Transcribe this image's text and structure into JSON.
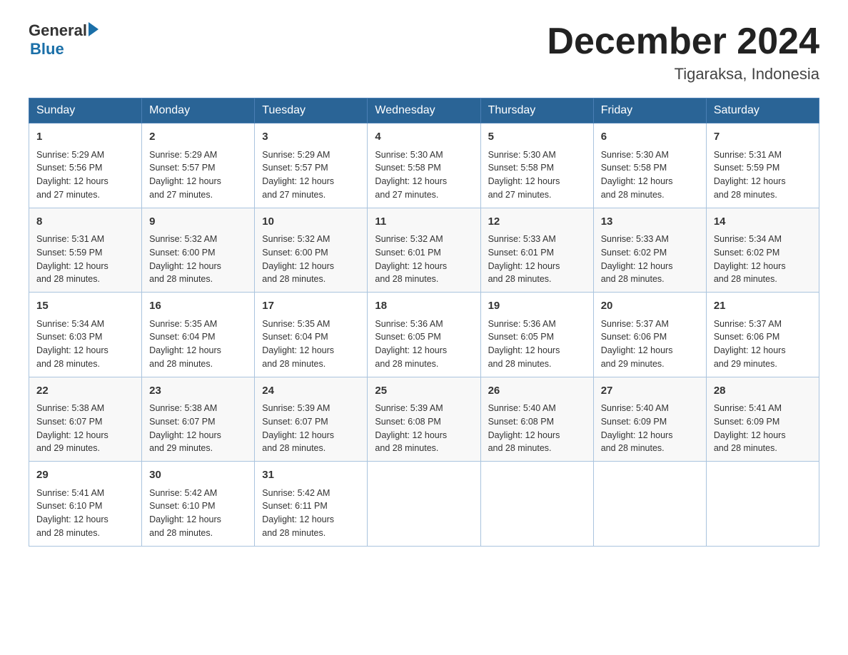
{
  "logo": {
    "text_general": "General",
    "triangle": "▶",
    "text_blue": "Blue"
  },
  "title": {
    "month_year": "December 2024",
    "location": "Tigaraksa, Indonesia"
  },
  "weekdays": [
    "Sunday",
    "Monday",
    "Tuesday",
    "Wednesday",
    "Thursday",
    "Friday",
    "Saturday"
  ],
  "weeks": [
    [
      {
        "day": "1",
        "sunrise": "5:29 AM",
        "sunset": "5:56 PM",
        "daylight": "12 hours and 27 minutes."
      },
      {
        "day": "2",
        "sunrise": "5:29 AM",
        "sunset": "5:57 PM",
        "daylight": "12 hours and 27 minutes."
      },
      {
        "day": "3",
        "sunrise": "5:29 AM",
        "sunset": "5:57 PM",
        "daylight": "12 hours and 27 minutes."
      },
      {
        "day": "4",
        "sunrise": "5:30 AM",
        "sunset": "5:58 PM",
        "daylight": "12 hours and 27 minutes."
      },
      {
        "day": "5",
        "sunrise": "5:30 AM",
        "sunset": "5:58 PM",
        "daylight": "12 hours and 27 minutes."
      },
      {
        "day": "6",
        "sunrise": "5:30 AM",
        "sunset": "5:58 PM",
        "daylight": "12 hours and 28 minutes."
      },
      {
        "day": "7",
        "sunrise": "5:31 AM",
        "sunset": "5:59 PM",
        "daylight": "12 hours and 28 minutes."
      }
    ],
    [
      {
        "day": "8",
        "sunrise": "5:31 AM",
        "sunset": "5:59 PM",
        "daylight": "12 hours and 28 minutes."
      },
      {
        "day": "9",
        "sunrise": "5:32 AM",
        "sunset": "6:00 PM",
        "daylight": "12 hours and 28 minutes."
      },
      {
        "day": "10",
        "sunrise": "5:32 AM",
        "sunset": "6:00 PM",
        "daylight": "12 hours and 28 minutes."
      },
      {
        "day": "11",
        "sunrise": "5:32 AM",
        "sunset": "6:01 PM",
        "daylight": "12 hours and 28 minutes."
      },
      {
        "day": "12",
        "sunrise": "5:33 AM",
        "sunset": "6:01 PM",
        "daylight": "12 hours and 28 minutes."
      },
      {
        "day": "13",
        "sunrise": "5:33 AM",
        "sunset": "6:02 PM",
        "daylight": "12 hours and 28 minutes."
      },
      {
        "day": "14",
        "sunrise": "5:34 AM",
        "sunset": "6:02 PM",
        "daylight": "12 hours and 28 minutes."
      }
    ],
    [
      {
        "day": "15",
        "sunrise": "5:34 AM",
        "sunset": "6:03 PM",
        "daylight": "12 hours and 28 minutes."
      },
      {
        "day": "16",
        "sunrise": "5:35 AM",
        "sunset": "6:04 PM",
        "daylight": "12 hours and 28 minutes."
      },
      {
        "day": "17",
        "sunrise": "5:35 AM",
        "sunset": "6:04 PM",
        "daylight": "12 hours and 28 minutes."
      },
      {
        "day": "18",
        "sunrise": "5:36 AM",
        "sunset": "6:05 PM",
        "daylight": "12 hours and 28 minutes."
      },
      {
        "day": "19",
        "sunrise": "5:36 AM",
        "sunset": "6:05 PM",
        "daylight": "12 hours and 28 minutes."
      },
      {
        "day": "20",
        "sunrise": "5:37 AM",
        "sunset": "6:06 PM",
        "daylight": "12 hours and 29 minutes."
      },
      {
        "day": "21",
        "sunrise": "5:37 AM",
        "sunset": "6:06 PM",
        "daylight": "12 hours and 29 minutes."
      }
    ],
    [
      {
        "day": "22",
        "sunrise": "5:38 AM",
        "sunset": "6:07 PM",
        "daylight": "12 hours and 29 minutes."
      },
      {
        "day": "23",
        "sunrise": "5:38 AM",
        "sunset": "6:07 PM",
        "daylight": "12 hours and 29 minutes."
      },
      {
        "day": "24",
        "sunrise": "5:39 AM",
        "sunset": "6:07 PM",
        "daylight": "12 hours and 28 minutes."
      },
      {
        "day": "25",
        "sunrise": "5:39 AM",
        "sunset": "6:08 PM",
        "daylight": "12 hours and 28 minutes."
      },
      {
        "day": "26",
        "sunrise": "5:40 AM",
        "sunset": "6:08 PM",
        "daylight": "12 hours and 28 minutes."
      },
      {
        "day": "27",
        "sunrise": "5:40 AM",
        "sunset": "6:09 PM",
        "daylight": "12 hours and 28 minutes."
      },
      {
        "day": "28",
        "sunrise": "5:41 AM",
        "sunset": "6:09 PM",
        "daylight": "12 hours and 28 minutes."
      }
    ],
    [
      {
        "day": "29",
        "sunrise": "5:41 AM",
        "sunset": "6:10 PM",
        "daylight": "12 hours and 28 minutes."
      },
      {
        "day": "30",
        "sunrise": "5:42 AM",
        "sunset": "6:10 PM",
        "daylight": "12 hours and 28 minutes."
      },
      {
        "day": "31",
        "sunrise": "5:42 AM",
        "sunset": "6:11 PM",
        "daylight": "12 hours and 28 minutes."
      },
      null,
      null,
      null,
      null
    ]
  ]
}
